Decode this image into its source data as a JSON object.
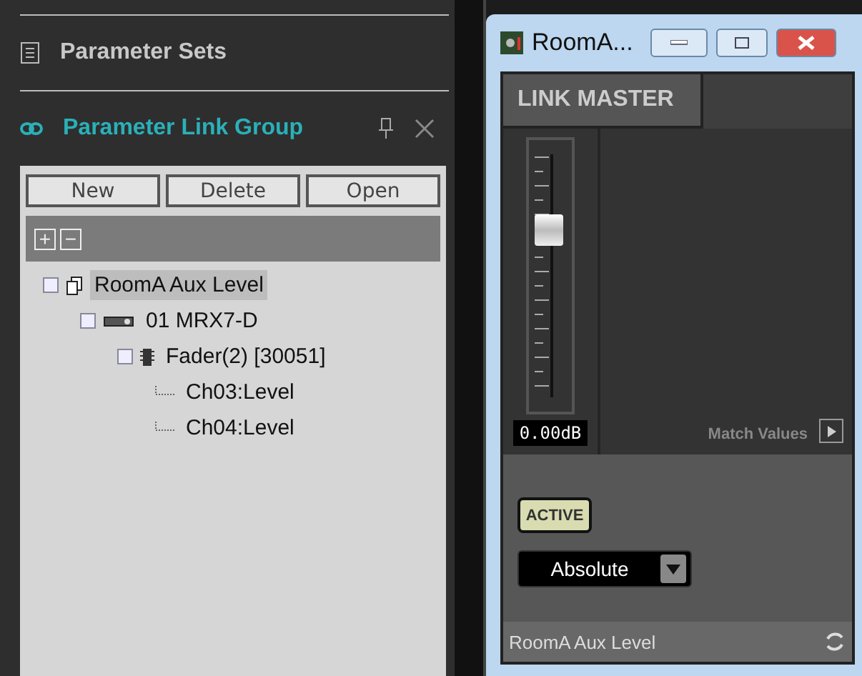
{
  "sidebar": {
    "sections": [
      {
        "title": "Parameter Sets",
        "selected": false
      },
      {
        "title": "Parameter Link Group",
        "selected": true
      }
    ],
    "buttons": [
      "New",
      "Delete",
      "Open"
    ],
    "toolbar": {
      "expand_all": "+",
      "collapse_all": "−"
    },
    "tree": [
      {
        "label": "RoomA Aux Level",
        "kind": "group",
        "expanded": true,
        "selected": true,
        "children": [
          {
            "label": "01 MRX7-D",
            "kind": "device",
            "expanded": true,
            "selected": false,
            "children": [
              {
                "label": "Fader(2) [30051]",
                "kind": "component",
                "expanded": true,
                "selected": false,
                "children": [
                  {
                    "label": "Ch03:Level",
                    "kind": "parameter",
                    "selected": false
                  },
                  {
                    "label": "Ch04:Level",
                    "kind": "parameter",
                    "selected": false
                  }
                ]
              }
            ]
          }
        ]
      }
    ]
  },
  "window": {
    "title": "RoomA...",
    "tab": "LINK MASTER",
    "fader": {
      "level": 0.72,
      "reading": "0.00dB"
    },
    "match_values": "Match Values",
    "active": {
      "label": "ACTIVE",
      "on": true
    },
    "mode": {
      "value": "Absolute"
    },
    "status": "RoomA Aux Level"
  }
}
